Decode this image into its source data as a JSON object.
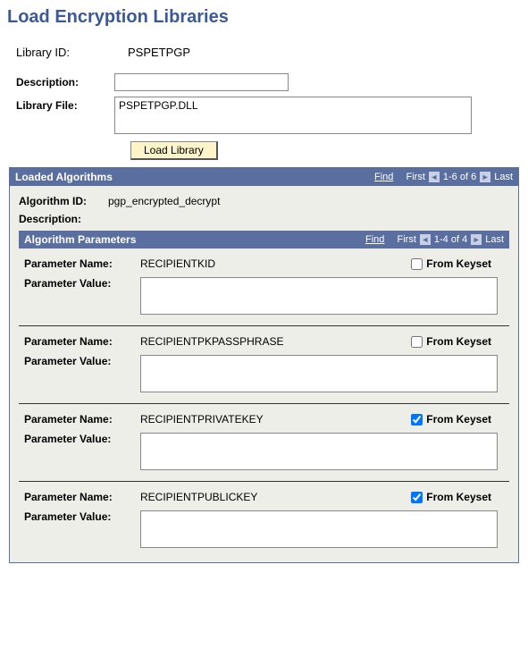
{
  "page_title": "Load Encryption Libraries",
  "top": {
    "library_id_label": "Library ID:",
    "library_id_value": "PSPETPGP",
    "description_label": "Description:",
    "description_value": "",
    "library_file_label": "Library File:",
    "library_file_value": "PSPETPGP.DLL",
    "load_button": "Load Library"
  },
  "algorithms_grid": {
    "title": "Loaded Algorithms",
    "nav": {
      "find": "Find",
      "first": "First",
      "range": "1-6 of 6",
      "last": "Last"
    },
    "algorithm_id_label": "Algorithm ID:",
    "algorithm_id_value": "pgp_encrypted_decrypt",
    "description_label": "Description:",
    "description_value": ""
  },
  "params_grid": {
    "title": "Algorithm Parameters",
    "nav": {
      "find": "Find",
      "first": "First",
      "range": "1-4 of 4",
      "last": "Last"
    },
    "param_name_label": "Parameter Name:",
    "param_value_label": "Parameter Value:",
    "from_keyset_label": "From Keyset",
    "rows": [
      {
        "name": "RECIPIENTKID",
        "value": "",
        "from_keyset": false
      },
      {
        "name": "RECIPIENTPKPASSPHRASE",
        "value": "",
        "from_keyset": false
      },
      {
        "name": "RECIPIENTPRIVATEKEY",
        "value": "",
        "from_keyset": true
      },
      {
        "name": "RECIPIENTPUBLICKEY",
        "value": "",
        "from_keyset": true
      }
    ]
  }
}
